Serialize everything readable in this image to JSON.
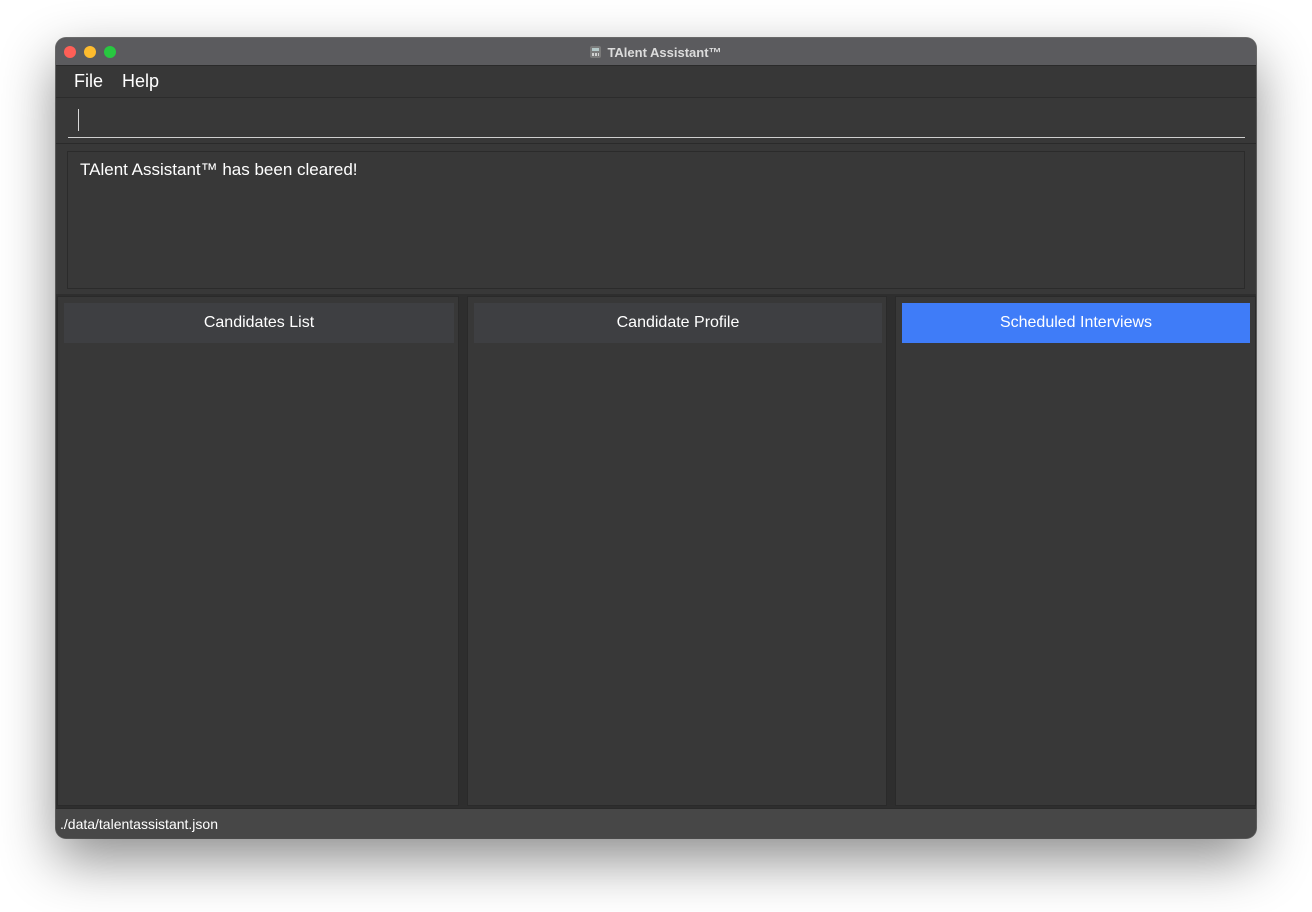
{
  "window": {
    "title": "TAlent Assistant™",
    "app_icon": "calculator-icon"
  },
  "menubar": {
    "items": [
      {
        "label": "File"
      },
      {
        "label": "Help"
      }
    ]
  },
  "command_box": {
    "value": "",
    "placeholder": ""
  },
  "result_display": {
    "text": "TAlent Assistant™ has been cleared!"
  },
  "panels": [
    {
      "tab_label": "Candidates List",
      "active": false
    },
    {
      "tab_label": "Candidate Profile",
      "active": false
    },
    {
      "tab_label": "Scheduled Interviews",
      "active": true
    }
  ],
  "statusbar": {
    "file_path": "./data/talentassistant.json"
  },
  "colors": {
    "background": "#383838",
    "active_tab": "#3f7cf8",
    "inactive_tab": "#3e3f42",
    "traffic_close": "#fe5f57",
    "traffic_minimize": "#febc2e",
    "traffic_maximize": "#28c840"
  }
}
